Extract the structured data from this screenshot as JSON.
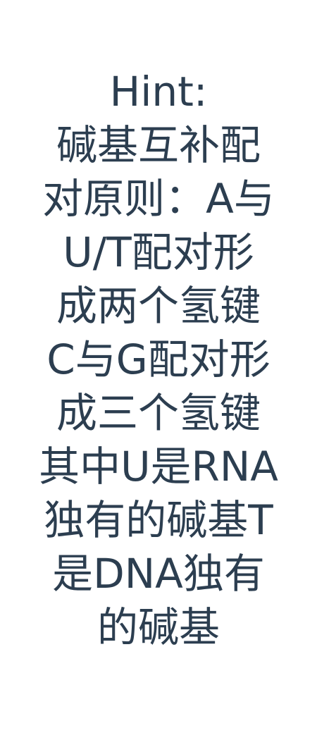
{
  "hint": {
    "title": "Hint:",
    "lines": [
      "碱基互补配",
      "对原则：A与",
      "U/T配对形",
      "成两个氢键",
      "C与G配对形",
      "成三个氢键",
      "其中U是RNA",
      "独有的碱基T",
      "是DNA独有",
      "的碱基"
    ]
  },
  "colors": {
    "text": "#2c3e50",
    "background": "#ffffff"
  }
}
